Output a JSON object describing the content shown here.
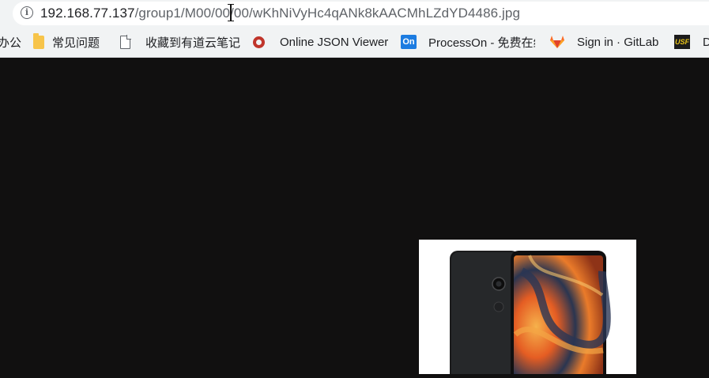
{
  "address_bar": {
    "host": "192.168.77.137",
    "path": "/group1/M00/00/00/wKhNiVyHc4qANk8kAACMhLZdYD4486.jpg",
    "info_glyph": "i"
  },
  "bookmarks": [
    {
      "label": "办公",
      "icon": "folder-icon"
    },
    {
      "label": "常见问题",
      "icon": "folder-icon"
    },
    {
      "label": "收藏到有道云笔记",
      "icon": "page-icon"
    },
    {
      "label": "Online JSON Viewer",
      "icon": "json-viewer-icon"
    },
    {
      "label": "ProcessOn - 免费在线作图",
      "icon": "processon-icon",
      "glyph": "On"
    },
    {
      "label": "Sign in · GitLab",
      "icon": "gitlab-icon"
    },
    {
      "label": "D",
      "icon": "usf-icon",
      "glyph": "USF"
    }
  ],
  "colors": {
    "page_background": "#111010",
    "toolbar": "#f1f3f4",
    "processon_blue": "#1d7ce1",
    "gitlab_orange": "#e24329",
    "folder_yellow": "#f7c44a"
  },
  "viewer": {
    "image_subject": "black smartphone front and back (product photo)"
  }
}
